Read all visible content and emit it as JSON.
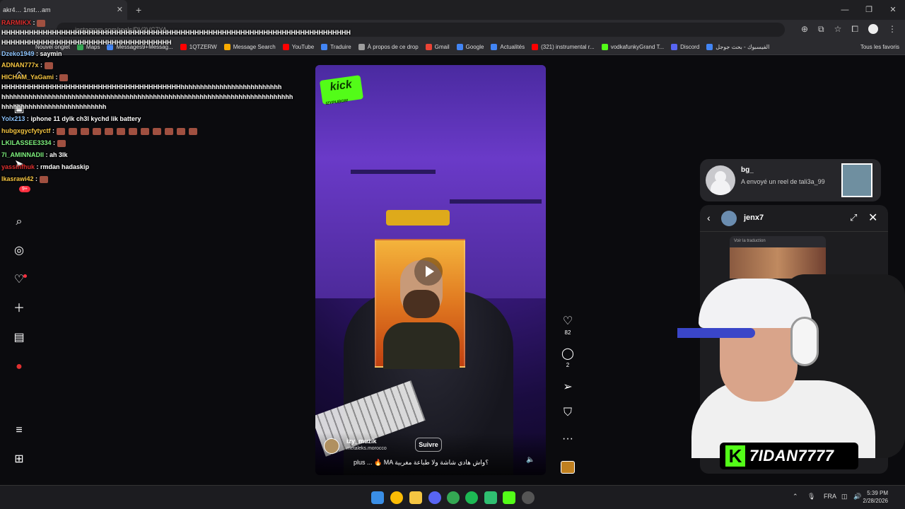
{
  "browser": {
    "tab_title": "akr4… 1nst…am",
    "new_tab_label": "Nouvel onglet",
    "url": "instagram.com/reels/DV3VC7YA..."
  },
  "bookmarks": [
    {
      "label": "Maps",
      "color": "#34a853"
    },
    {
      "label": "Messages9+Messag...",
      "color": "#4285f4"
    },
    {
      "label": "1QTZERW",
      "color": "#ff0000"
    },
    {
      "label": "Message Search",
      "color": "#f9ab00"
    },
    {
      "label": "YouTube",
      "color": "#ff0000"
    },
    {
      "label": "Traduire",
      "color": "#4285f4"
    },
    {
      "label": "À propos de ce drop",
      "color": "#9e9e9e"
    },
    {
      "label": "Gmail",
      "color": "#ea4335"
    },
    {
      "label": "Google",
      "color": "#4285f4"
    },
    {
      "label": "Actualités",
      "color": "#4285f4"
    },
    {
      "label": "(321) instrumental r...",
      "color": "#ff0000"
    },
    {
      "label": "vodkafunkyGrand T...",
      "color": "#53fc18"
    },
    {
      "label": "Discord",
      "color": "#5865f2"
    },
    {
      "label": "الفيسبوك - بحث جوجل",
      "color": "#4285f4"
    }
  ],
  "bookmarks_all": "Tous les favoris",
  "chat": [
    {
      "user": "RARMIKX",
      "msg": "",
      "user_color": "#e03030"
    },
    {
      "user": "",
      "msg": "HHHHHHHHHHHHHHHHHHHHHHHHHHHHHHHHHHHHHHHHHHHHHHHHHHHHHHHHHHHHHHHHHHHHHHHHHHHH",
      "user_color": "#ffffff"
    },
    {
      "user": "",
      "msg": "HHHHHHHHHHHHHHHHHHHHHHHHHHHHHHHHHHHHH",
      "user_color": "#ffffff"
    },
    {
      "user": "Dzeko1949",
      "msg": "saymin",
      "user_color": "#8ec5ff"
    },
    {
      "user": "ADNAN777x",
      "msg": "",
      "user_color": "#f5c542"
    },
    {
      "user": "HICHAM_YaGami",
      "msg": "",
      "user_color": "#f5c542"
    },
    {
      "user": "",
      "msg": "HHHHHHHHHHHHHHHHHHHHHHHHHHHHHHHHHHHHHHHhhhhhhhhhhhhhhhhhhhhhhhhhh",
      "user_color": "#ffffff"
    },
    {
      "user": "",
      "msg": "hhhhhhhhhhhhhhhhhhhhhhhhhhhhhhhhhhhhhhhhhhhhhhhhhhhhhhhhhhhhhhhhhhhhhhhhhhh",
      "user_color": "#ffffff"
    },
    {
      "user": "",
      "msg": "hhhhhhhhhhhhhhhhhhhhhhhhhhh",
      "user_color": "#ffffff"
    },
    {
      "user": "Yolx213",
      "msg": "iphone 11 dylk ch3l kychd lik battery",
      "user_color": "#8ec5ff"
    },
    {
      "user": "hubgxgycfytyctf",
      "msg": "",
      "user_color": "#f5c542"
    },
    {
      "user": "LKILASSEE3334",
      "msg": "",
      "user_color": "#7ef07e"
    },
    {
      "user": "7l_AMINNADII",
      "msg": "ah 3lk",
      "user_color": "#7ef07e"
    },
    {
      "user": "yassinfhuk",
      "msg": "rmdan hadaskip",
      "user_color": "#e03030"
    },
    {
      "user": "lkasrawi42",
      "msg": "",
      "user_color": "#f5c542"
    }
  ],
  "reel": {
    "watermark": "kick",
    "watermark_sub": "IZYPUBGM",
    "author": "izy_muzik",
    "audio": "metaleks.morocco",
    "follow_label": "Suivre",
    "caption": "plus ... 🔥 MA ؟واش هادي شاشة ولا طباعة مغربية",
    "likes": "82",
    "comments": "2"
  },
  "notification": {
    "name": "bg_",
    "text": "A envoyé un reel de tali3a_99"
  },
  "dm": {
    "name": "jenx7",
    "translate_label": "Voir la traduction"
  },
  "streamer": {
    "name": "7IDAN7777",
    "logo_letter": "K"
  },
  "taskbar": {
    "lang": "FRA",
    "time": "5:39 PM",
    "date": "2/28/2026"
  }
}
